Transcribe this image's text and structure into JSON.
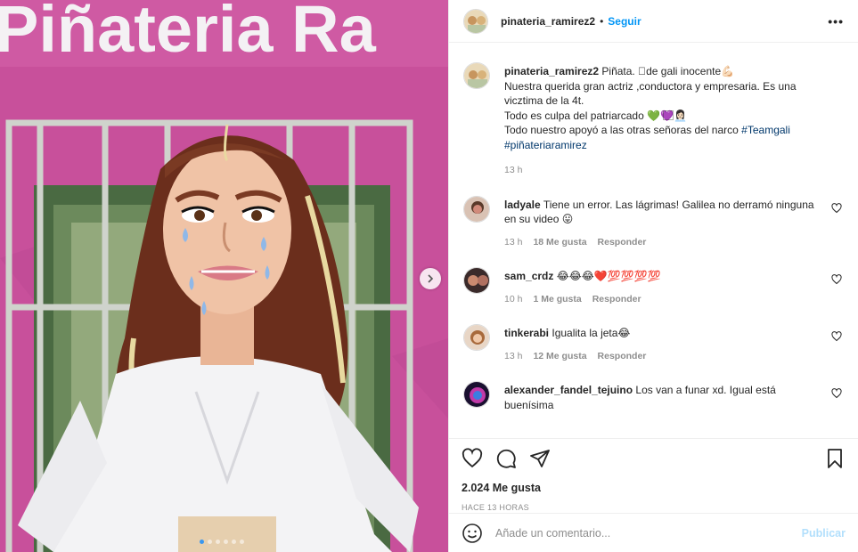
{
  "photo": {
    "wall_text": "Piñateria Ra",
    "carousel_dots": 6,
    "active_dot": 0
  },
  "header": {
    "username": "pinateria_ramirez2",
    "separator": "•",
    "follow_label": "Seguir",
    "more_label": "•••"
  },
  "caption": {
    "username": "pinateria_ramirez2",
    "lines": [
      "Piñata. ⃞de gali inocente💪🏻",
      "Nuestra querida gran actriz ,conductora y empresaria. Es una vicztima de la 4t.",
      "Todo es culpa del patriarcado 💚💜⃞👩🏻‍💼",
      "Todo nuestro apoyó a las otras señoras del narco"
    ],
    "hashtags": [
      "#Teamgali",
      "#piñateriaramirez"
    ],
    "time": "13 h"
  },
  "comments": [
    {
      "username": "ladyale",
      "text": "Tiene un error. Las lágrimas! Galilea no derramó ninguna en su video 😛",
      "time": "13 h",
      "likes": "18 Me gusta",
      "reply": "Responder"
    },
    {
      "username": "sam_crdz",
      "text": "😂😂😂❤️💯💯💯💯",
      "time": "10 h",
      "likes": "1 Me gusta",
      "reply": "Responder"
    },
    {
      "username": "tinkerabi",
      "text": "Igualita la jeta😂",
      "time": "13 h",
      "likes": "12 Me gusta",
      "reply": "Responder"
    },
    {
      "username": "alexander_fandel_tejuino",
      "text": "Los van a funar xd. Igual está buenísima"
    }
  ],
  "actions": {
    "likes": "2.024 Me gusta",
    "posted": "HACE 13 HORAS"
  },
  "add_comment": {
    "placeholder": "Añade un comentario...",
    "post_label": "Publicar"
  },
  "colors": {
    "link": "#0095f6",
    "hashtag": "#00376b",
    "muted": "#8e8e8e",
    "wall": "#c94f9c"
  }
}
